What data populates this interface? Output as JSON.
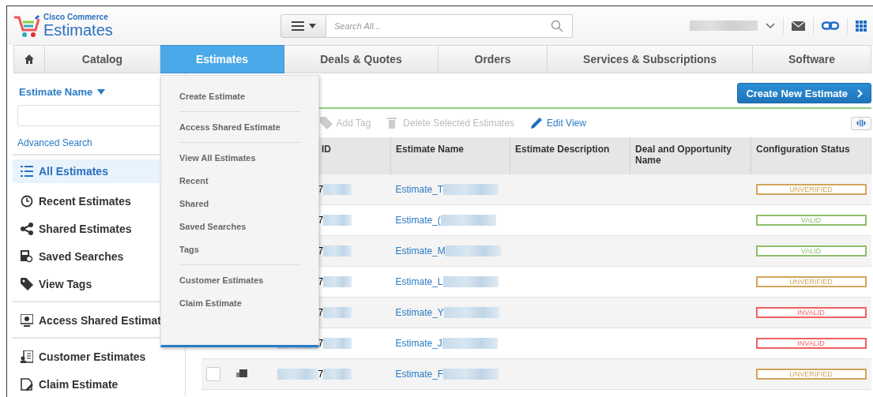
{
  "header": {
    "brand": "Cisco Commerce",
    "app_title": "Estimates",
    "search": {
      "placeholder": "Search All..."
    }
  },
  "nav": [
    {
      "kind": "home",
      "selected": false
    },
    {
      "label": "Catalog",
      "selected": false
    },
    {
      "label": "Estimates",
      "selected": true
    },
    {
      "label": "Deals & Quotes",
      "selected": false
    },
    {
      "label": "Orders",
      "selected": false
    },
    {
      "label": "Services & Subscriptions",
      "selected": false
    },
    {
      "label": "Software",
      "selected": false
    }
  ],
  "sidebar": {
    "filter_label": "Estimate Name",
    "advanced_search": "Advanced Search",
    "groups": [
      [
        {
          "label": "All Estimates",
          "selected": true
        },
        {
          "label": "Recent Estimates",
          "selected": false
        },
        {
          "label": "Shared Estimates",
          "selected": false
        },
        {
          "label": "Saved Searches",
          "selected": false
        },
        {
          "label": "View Tags",
          "selected": false
        }
      ],
      [
        {
          "label": "Access Shared Estimat",
          "selected": false
        }
      ],
      [
        {
          "label": "Customer Estimates",
          "selected": false
        },
        {
          "label": "Claim Estimate",
          "selected": false
        }
      ]
    ]
  },
  "menu": {
    "sections": [
      [
        "Create Estimate"
      ],
      [
        "Access Shared Estimate"
      ],
      [
        "View All Estimates",
        "Recent",
        "Shared",
        "Saved Searches",
        "Tags"
      ],
      [
        "Customer Estimates",
        "Claim Estimate"
      ]
    ]
  },
  "create_button": "Create New Estimate",
  "toolbar": [
    {
      "label": "Add Tag",
      "disabled": true
    },
    {
      "label": "Delete Selected Estimates",
      "disabled": true
    },
    {
      "label": "Edit View",
      "disabled": false
    }
  ],
  "table": {
    "columns": [
      "ID",
      "Estimate Name",
      "Estimate Description",
      "Deal and Opportunity Name",
      "Configuration Status"
    ],
    "rows": [
      {
        "id": "7",
        "name": "Estimate_T",
        "status": "UNVERIFIED",
        "color": "#d2a55a"
      },
      {
        "id": "7",
        "name": "Estimate_(",
        "status": "VALID",
        "color": "#8cbf6a"
      },
      {
        "id": "7",
        "name": "Estimate_M",
        "status": "VALID",
        "color": "#8cbf6a"
      },
      {
        "id": "7",
        "name": "Estimate_L",
        "status": "UNVERIFIED",
        "color": "#d2a55a"
      },
      {
        "id": "7",
        "name": "Estimate_Y",
        "status": "INVALID",
        "color": "#f06060"
      },
      {
        "id": "7",
        "name": "Estimate_J",
        "status": "INVALID",
        "color": "#f06060"
      },
      {
        "id": "7",
        "name": "Estimate_F",
        "status": "UNVERIFIED",
        "color": "#d2a55a",
        "checked": false
      }
    ]
  }
}
